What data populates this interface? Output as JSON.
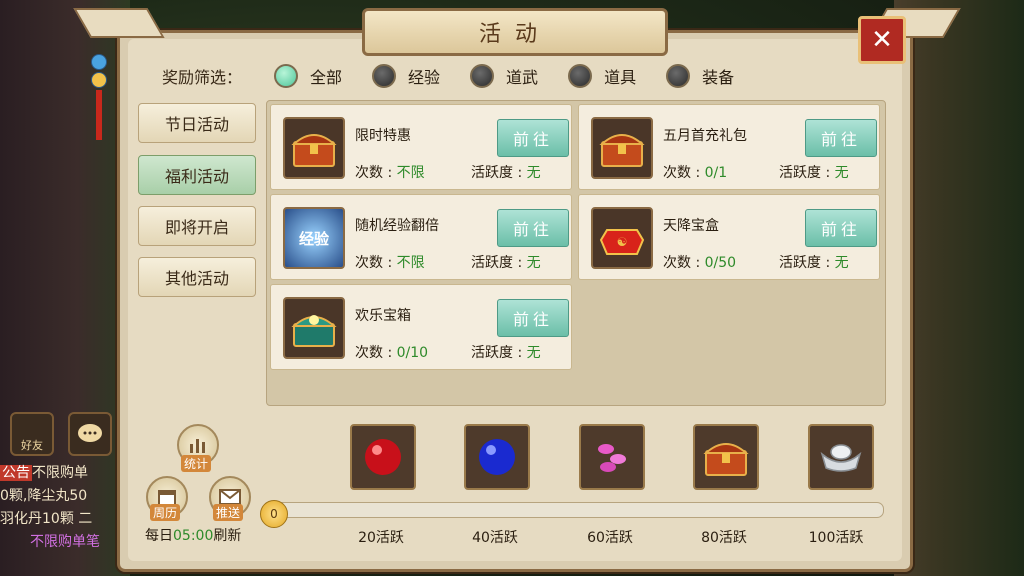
{
  "title": "活动",
  "close_label": "✕",
  "filter": {
    "label": "奖励筛选：",
    "options": [
      {
        "label": "全部",
        "selected": true
      },
      {
        "label": "经验",
        "selected": false
      },
      {
        "label": "道武",
        "selected": false
      },
      {
        "label": "道具",
        "selected": false
      },
      {
        "label": "装备",
        "selected": false
      }
    ]
  },
  "tabs": [
    {
      "label": "节日活动",
      "active": false
    },
    {
      "label": "福利活动",
      "active": true
    },
    {
      "label": "即将开启",
      "active": false
    },
    {
      "label": "其他活动",
      "active": false
    }
  ],
  "activities": [
    {
      "name": "限时特惠",
      "go": "前往",
      "count_label": "次数 : ",
      "count": "不限",
      "activity_label": "活跃度 : ",
      "activity": "无",
      "icon": "treasure-chest-icon"
    },
    {
      "name": "五月首充礼包",
      "go": "前往",
      "count_label": "次数 : ",
      "count": "0/1",
      "activity_label": "活跃度 : ",
      "activity": "无",
      "icon": "treasure-chest-icon"
    },
    {
      "name": "随机经验翻倍",
      "go": "前往",
      "count_label": "次数 : ",
      "count": "不限",
      "activity_label": "活跃度 : ",
      "activity": "无",
      "icon": "experience-icon",
      "icon_text": "经验"
    },
    {
      "name": "天降宝盒",
      "go": "前往",
      "count_label": "次数 : ",
      "count": "0/50",
      "activity_label": "活跃度 : ",
      "activity": "无",
      "icon": "red-giftbox-icon"
    },
    {
      "name": "欢乐宝箱",
      "go": "前往",
      "count_label": "次数 : ",
      "count": "0/10",
      "activity_label": "活跃度 : ",
      "activity": "无",
      "icon": "green-chest-icon"
    }
  ],
  "bottom": {
    "stats_label": "统计",
    "calendar_label": "周历",
    "push_label": "推送",
    "refresh_prefix": "每日",
    "refresh_time": "05:00",
    "refresh_suffix": "刷新",
    "progress_value": "0",
    "rewards": [
      {
        "label": "20活跃",
        "icon": "red-orb-icon"
      },
      {
        "label": "40活跃",
        "icon": "blue-orb-icon"
      },
      {
        "label": "60活跃",
        "icon": "pink-gems-icon"
      },
      {
        "label": "80活跃",
        "icon": "treasure-chest-icon"
      },
      {
        "label": "100活跃",
        "icon": "silver-ingot-icon"
      }
    ]
  },
  "background": {
    "friend_label": "好友",
    "ticker": {
      "tag": "公告",
      "line1": "不限购单",
      "line2": "0颗,降尘丸50",
      "line3": "羽化丹10颗 二",
      "line4": "不限购单笔"
    }
  },
  "colors": {
    "accent_green": "#2e8a2a",
    "close_red": "#b02a22",
    "go_button": "#6bbfa8"
  }
}
